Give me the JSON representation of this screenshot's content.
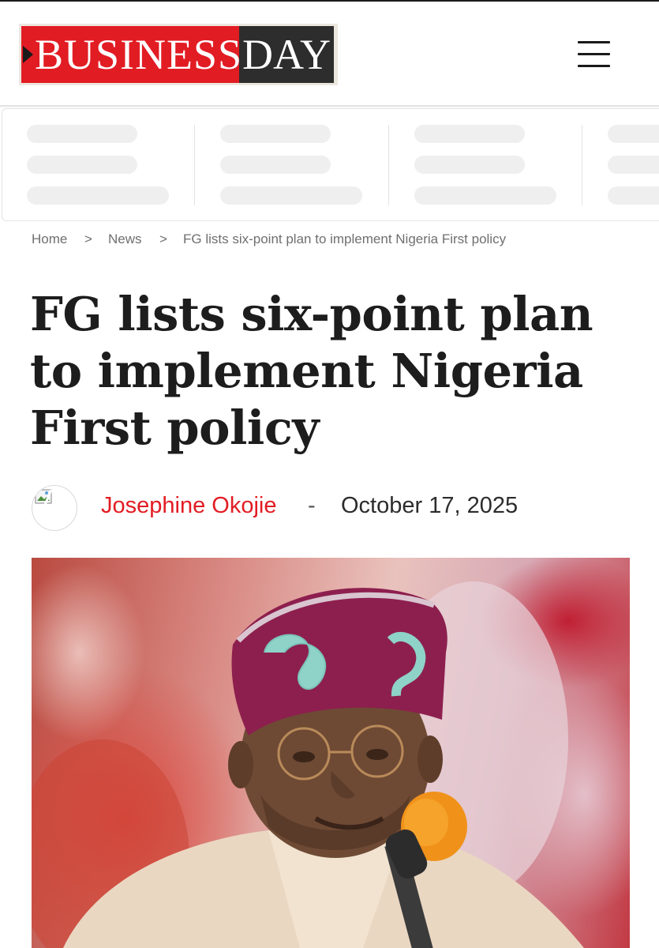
{
  "header": {
    "logo_primary": "BUSINESS",
    "logo_secondary": "DAY",
    "menu_icon": "hamburger-menu-icon",
    "brand_red": "#e21c23",
    "brand_dark": "#2d2d2d"
  },
  "breadcrumb": {
    "items": [
      "Home",
      "News",
      "FG lists six-point plan to implement Nigeria First policy"
    ],
    "separator": ">"
  },
  "article": {
    "title_lines": [
      "FG lists six-point plan",
      "to implement Nigeria",
      "First policy"
    ],
    "author": "Josephine Okojie",
    "separator": "-",
    "date": "October 17, 2025",
    "author_color": "#e21c23"
  }
}
